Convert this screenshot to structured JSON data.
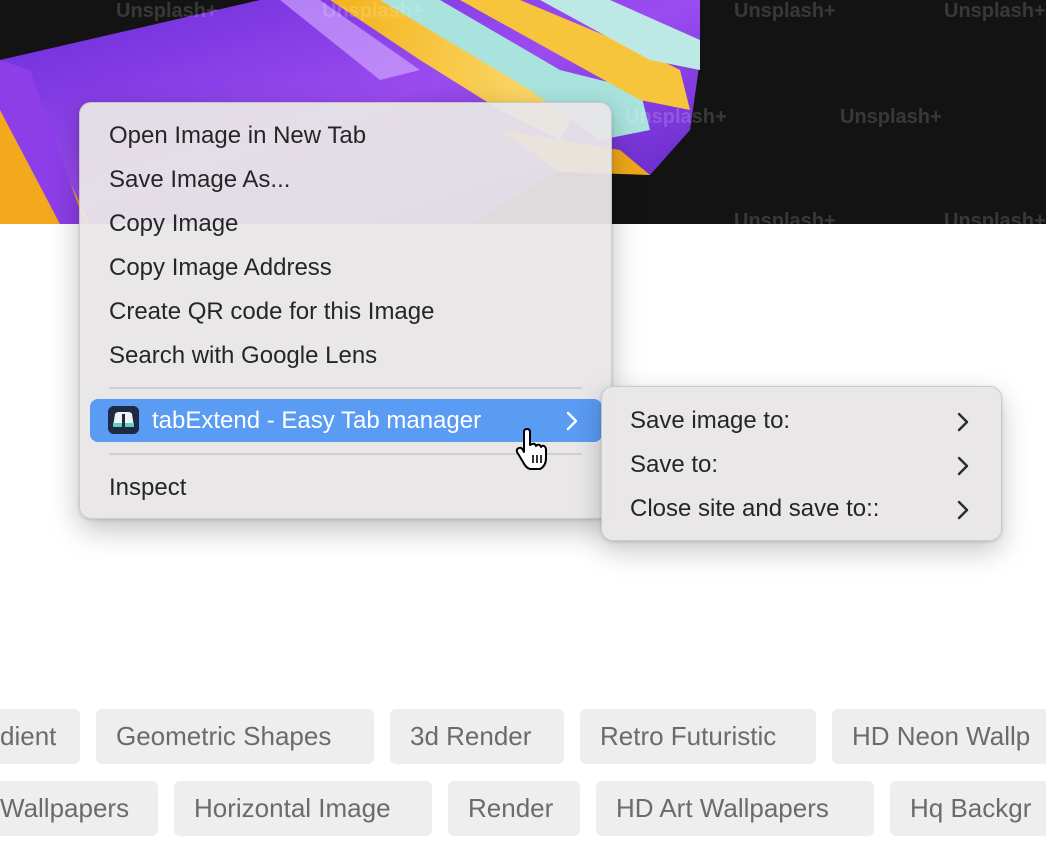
{
  "hero": {
    "watermark": "Unsplash+"
  },
  "context_menu": {
    "items": [
      {
        "label": "Open Image in New Tab"
      },
      {
        "label": "Save Image As..."
      },
      {
        "label": "Copy Image"
      },
      {
        "label": "Copy Image Address"
      },
      {
        "label": "Create QR code for this Image"
      },
      {
        "label": "Search with Google Lens"
      }
    ],
    "extension_item": {
      "label": "tabExtend - Easy Tab manager",
      "icon": "tabextend-icon"
    },
    "inspect_label": "Inspect",
    "highlight_color": "#5a9bf3"
  },
  "submenu": {
    "items": [
      {
        "label": "Save image to:"
      },
      {
        "label": "Save to:"
      },
      {
        "label": "Close site and save to::"
      }
    ]
  },
  "tags": {
    "row1": [
      "dient",
      "Geometric Shapes",
      "3d Render",
      "Retro Futuristic",
      "HD Neon Wallp"
    ],
    "row2": [
      "Wallpapers",
      "Horizontal Image",
      "Render",
      "HD Art Wallpapers",
      "Hq Backgr"
    ]
  }
}
